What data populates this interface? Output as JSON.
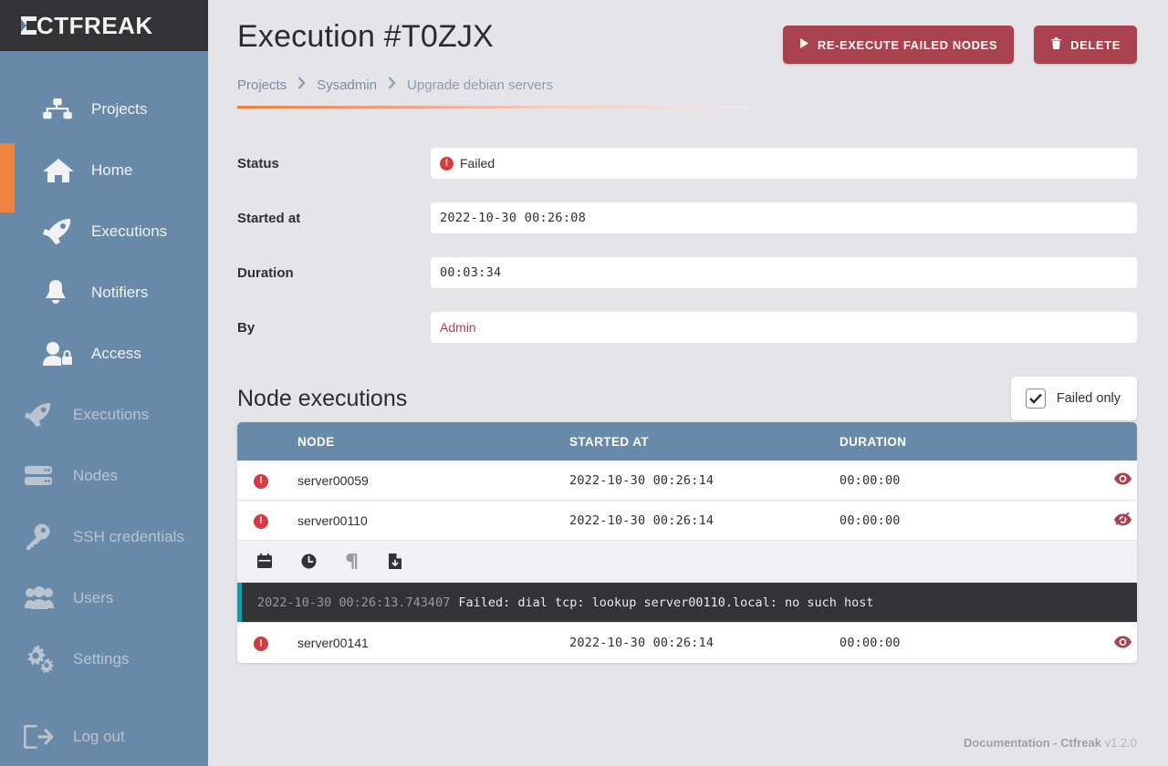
{
  "brand": {
    "logo_text": "CTFREAK"
  },
  "sidebar": {
    "primary_items": [
      {
        "label": "Projects",
        "icon": "sitemap-icon"
      },
      {
        "label": "Home",
        "icon": "home-icon"
      },
      {
        "label": "Executions",
        "icon": "rocket-icon"
      },
      {
        "label": "Notifiers",
        "icon": "bell-icon"
      },
      {
        "label": "Access",
        "icon": "user-lock-icon"
      }
    ],
    "secondary_items": [
      {
        "label": "Executions",
        "icon": "rocket-icon"
      },
      {
        "label": "Nodes",
        "icon": "server-icon"
      },
      {
        "label": "SSH credentials",
        "icon": "key-icon"
      },
      {
        "label": "Users",
        "icon": "users-icon"
      },
      {
        "label": "Settings",
        "icon": "cogs-icon"
      }
    ],
    "logout": {
      "label": "Log out",
      "icon": "sign-out-icon"
    }
  },
  "header": {
    "title": "Execution #T0ZJX",
    "buttons": [
      {
        "label": "RE-EXECUTE FAILED NODES",
        "icon": "play-icon"
      },
      {
        "label": "DELETE",
        "icon": "trash-icon"
      }
    ]
  },
  "breadcrumb": {
    "items": [
      "Projects",
      "Sysadmin",
      "Upgrade debian servers"
    ],
    "separator_icon": "chevron-right-icon"
  },
  "details": {
    "rows": [
      {
        "label": "Status",
        "value": "Failed",
        "kind": "status",
        "icon": "exclamation-circle-icon"
      },
      {
        "label": "Started at",
        "value": "2022-10-30 00:26:08",
        "kind": "mono"
      },
      {
        "label": "Duration",
        "value": "00:03:34",
        "kind": "mono"
      },
      {
        "label": "By",
        "value": "Admin",
        "kind": "link"
      }
    ]
  },
  "node_executions": {
    "title": "Node executions",
    "filter": {
      "label": "Failed only",
      "checked": true,
      "icon": "check-icon"
    },
    "columns": [
      "",
      "NODE",
      "STARTED AT",
      "DURATION",
      ""
    ],
    "rows": [
      {
        "status_icon": "exclamation-circle-icon",
        "node": "server00059",
        "started_at": "2022-10-30 00:26:14",
        "duration": "00:00:00",
        "toggle_icon": "eye-icon",
        "expanded": false
      },
      {
        "status_icon": "exclamation-circle-icon",
        "node": "server00110",
        "started_at": "2022-10-30 00:26:14",
        "duration": "00:00:00",
        "toggle_icon": "eye-slash-icon",
        "expanded": true
      },
      {
        "status_icon": "exclamation-circle-icon",
        "node": "server00141",
        "started_at": "2022-10-30 00:26:14",
        "duration": "00:00:00",
        "toggle_icon": "eye-icon",
        "expanded": false
      }
    ],
    "expanded_detail": {
      "toolbar": [
        {
          "icon": "calendar-icon",
          "disabled": false
        },
        {
          "icon": "clock-icon",
          "disabled": false
        },
        {
          "icon": "paragraph-icon",
          "disabled": true
        },
        {
          "icon": "file-download-icon",
          "disabled": false
        }
      ],
      "log_timestamp": "2022-10-30 00:26:13.743407",
      "log_message": "Failed: dial tcp: lookup server00110.local: no such host"
    }
  },
  "footer": {
    "documentation": "Documentation",
    "dash": " - ",
    "product": "Ctfreak",
    "version": "v1.2.0"
  }
}
